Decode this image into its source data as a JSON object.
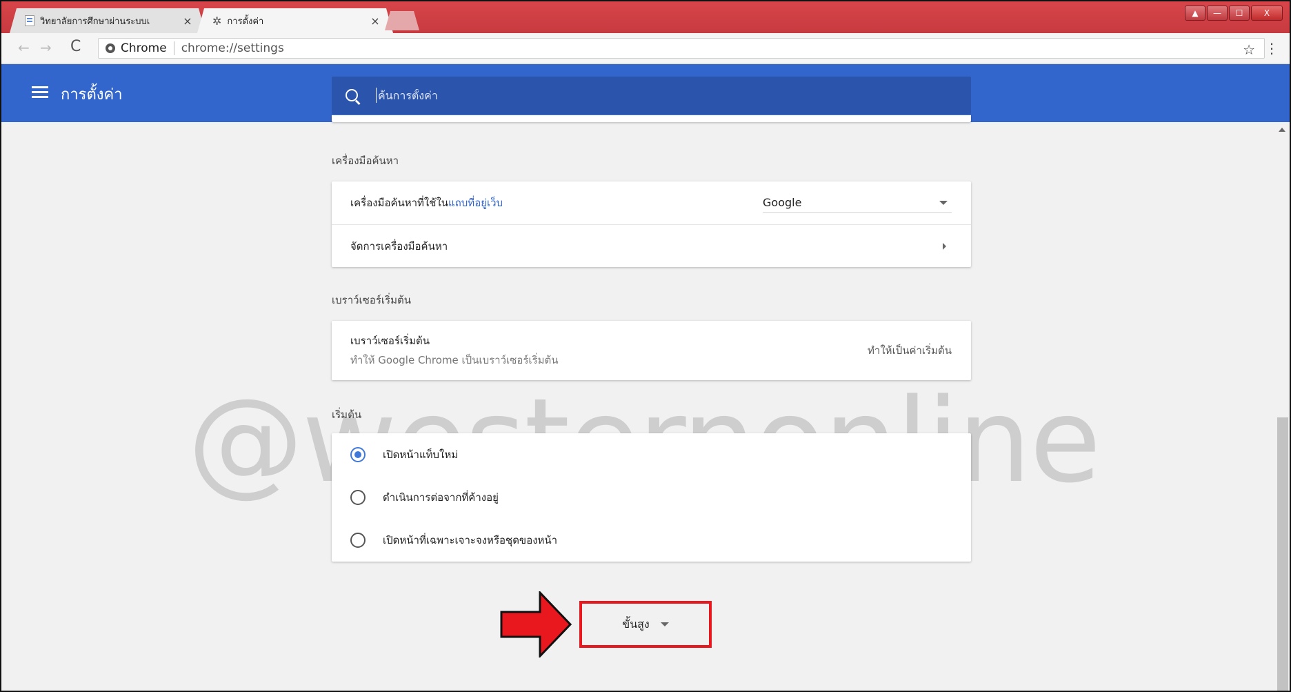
{
  "tabs": [
    {
      "title": "วิทยาลัยการศึกษาผ่านระบบเ",
      "active": false,
      "close_icon": "×"
    },
    {
      "title": "การตั้งค่า",
      "active": true,
      "close_icon": "×"
    }
  ],
  "window_controls": {
    "user": "▲",
    "minimize": "—",
    "maximize": "☐",
    "close": "X"
  },
  "toolbar": {
    "back": "←",
    "forward": "→",
    "reload": "C",
    "origin_label": "Chrome",
    "url": "chrome://settings",
    "star": "☆",
    "menu": "⋮"
  },
  "header": {
    "title": "การตั้งค่า",
    "search_placeholder": "ค้นการตั้งค่า"
  },
  "sections": {
    "search_engine": {
      "title": "เครื่องมือค้นหา",
      "row1_text": "เครื่องมือค้นหาที่ใช้ใน",
      "row1_link": "แถบที่อยู่เว็บ",
      "row1_value": "Google",
      "row2_text": "จัดการเครื่องมือค้นหา"
    },
    "default_browser": {
      "title": "เบราว์เซอร์เริ่มต้น",
      "primary": "เบราว์เซอร์เริ่มต้น",
      "secondary": "ทำให้ Google Chrome เป็นเบราว์เซอร์เริ่มต้น",
      "action": "ทำให้เป็นค่าเริ่มต้น"
    },
    "on_startup": {
      "title": "เริ่มต้น",
      "options": [
        {
          "label": "เปิดหน้าแท็บใหม่",
          "selected": true
        },
        {
          "label": "ดำเนินการต่อจากที่ค้างอยู่",
          "selected": false
        },
        {
          "label": "เปิดหน้าที่เฉพาะเจาะจงหรือชุดของหน้า",
          "selected": false
        }
      ]
    }
  },
  "advanced": {
    "label": "ขั้นสูง"
  },
  "watermark": "@westernonline",
  "colors": {
    "accent": "#3366cc",
    "search_bg": "#2b54ad",
    "tabbar": "#c73a3f",
    "highlight": "#e8181e"
  },
  "icons": {
    "tab1": "document-icon",
    "tab2": "gear-icon",
    "search": "search-icon",
    "menu": "hamburger-icon",
    "annotation": "red-arrow-icon"
  }
}
